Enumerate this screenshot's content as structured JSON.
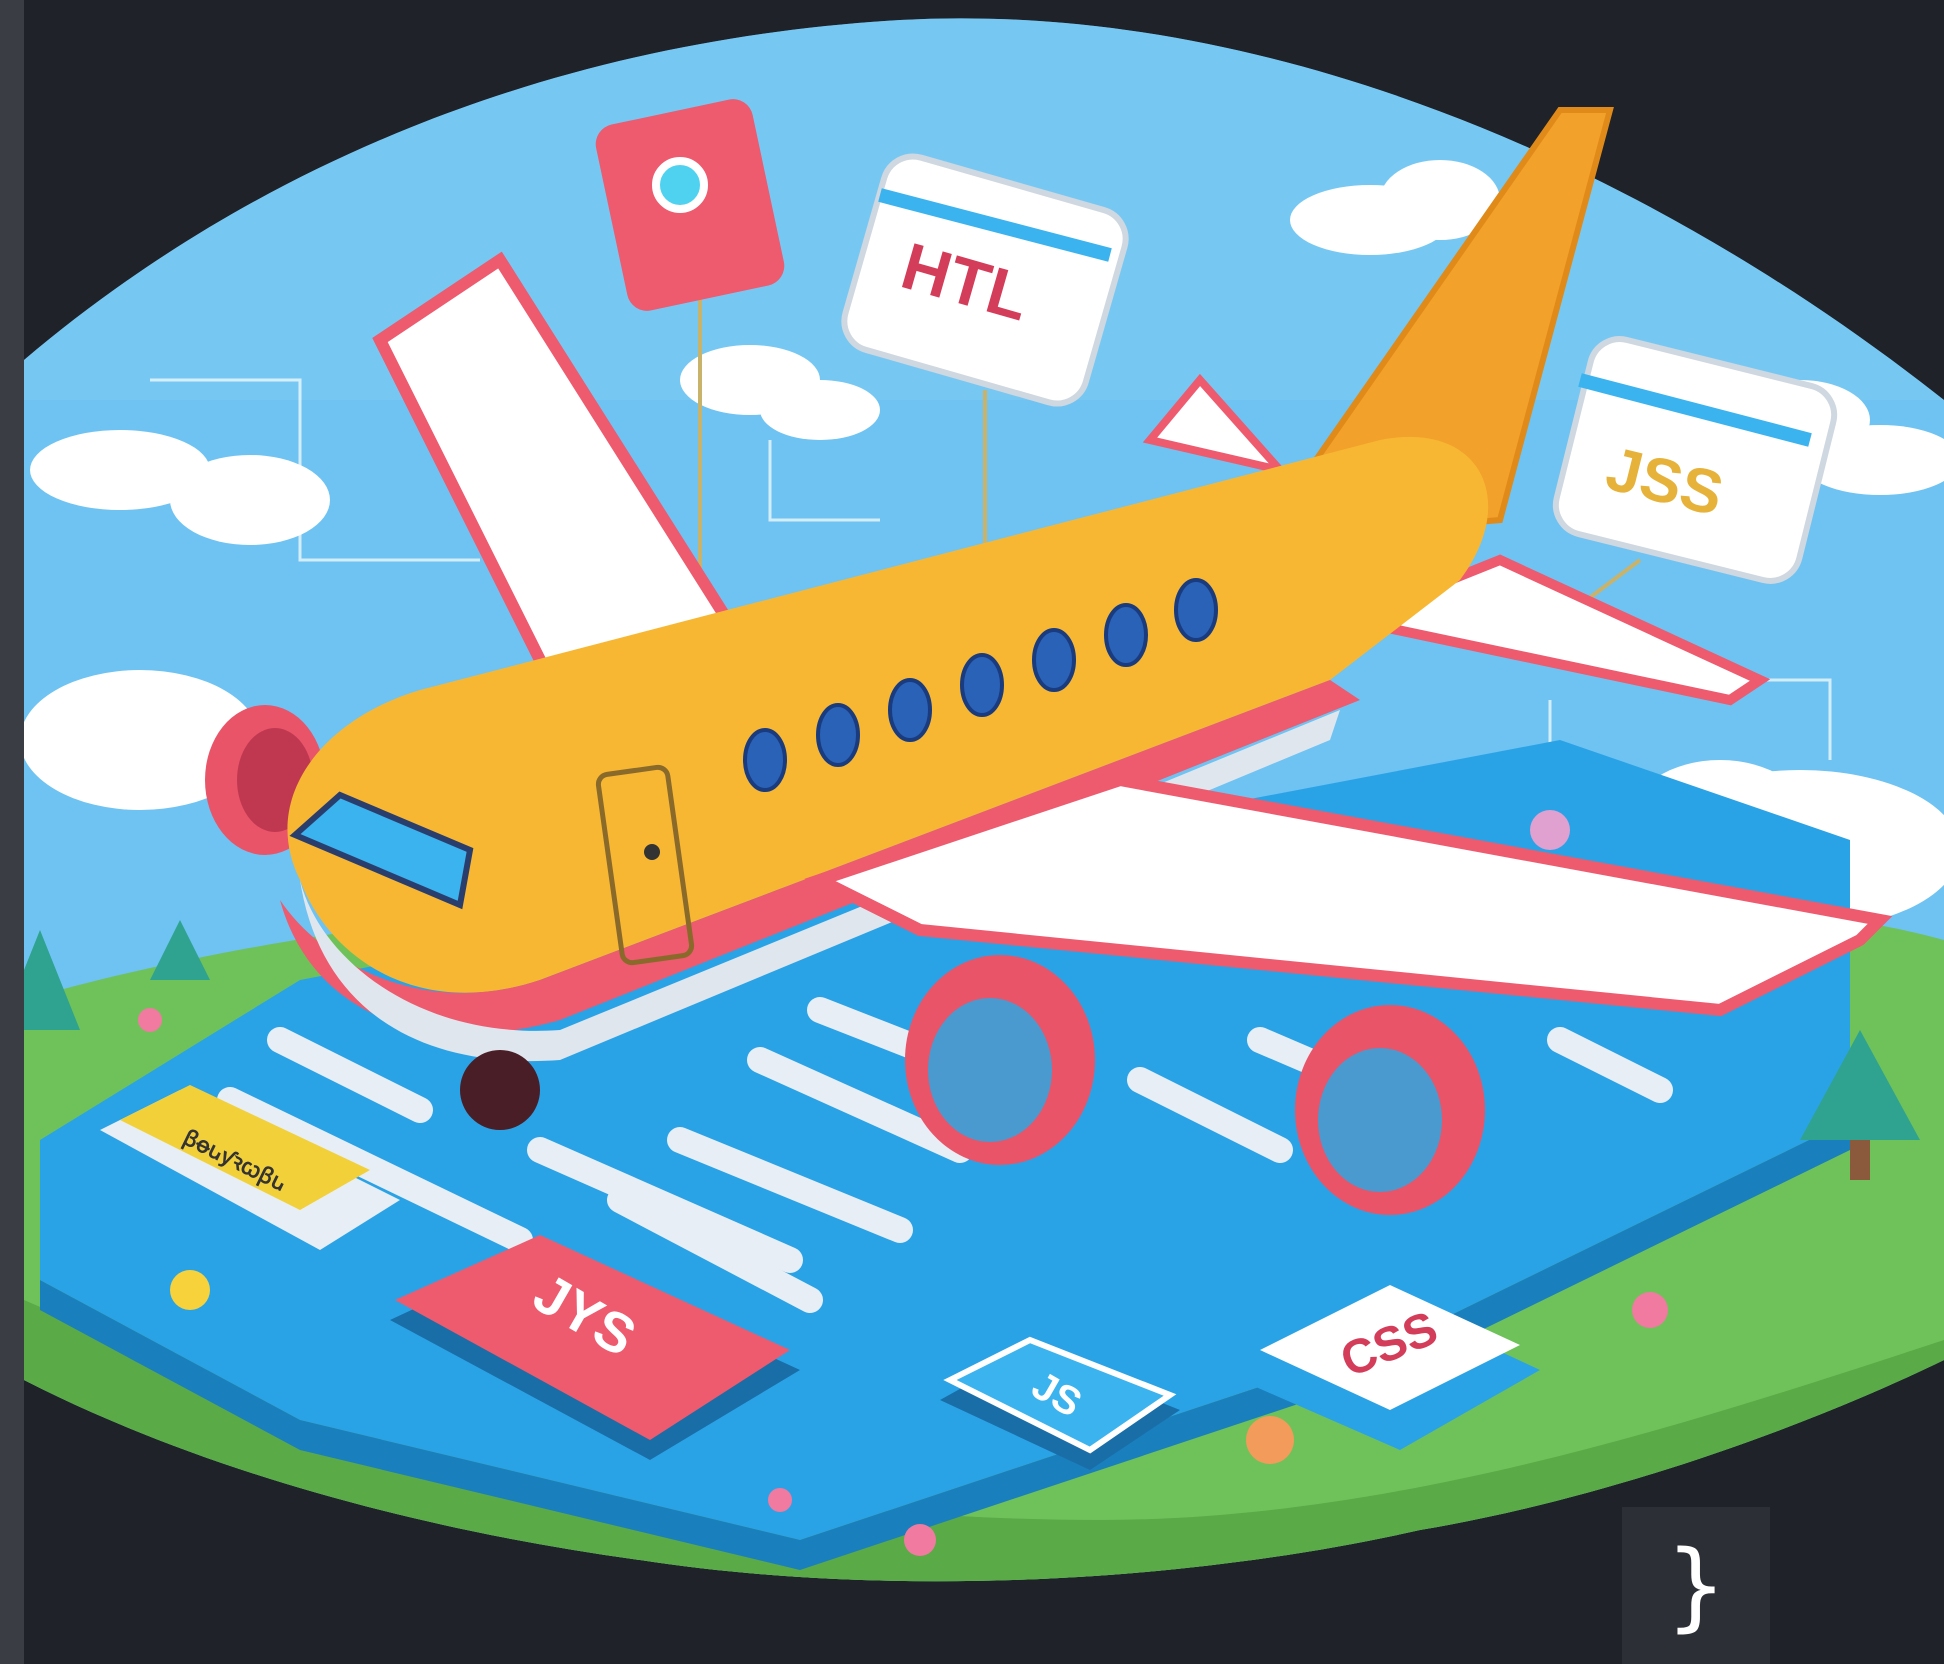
{
  "scene": {
    "labels": {
      "htl_sign": "HTL",
      "jss_sign": "JSS",
      "jys_key": "JYS",
      "js_key": "JS",
      "css_key": "CSS",
      "scribble_key": "ꞵꝋꭎƴꝛꞷꞵꭎ"
    },
    "colors": {
      "background": "#1f2228",
      "sky": "#6ec3f2",
      "grass": "#6fc25a",
      "keyboard": "#2aa3e6",
      "fuselage": "#f7b733",
      "stripe": "#ee5a6e",
      "tail": "#f2a12b",
      "engine": "#e95468"
    },
    "icons": [
      "plane-illustration",
      "camera-sign-icon",
      "cloud-icon",
      "tree-icon",
      "flower-icon",
      "ball-icon"
    ]
  },
  "code_panel": {
    "brace": "}"
  }
}
